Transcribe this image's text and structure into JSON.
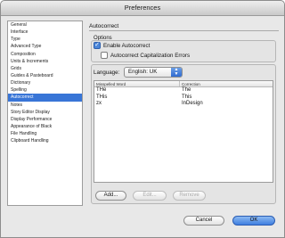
{
  "window": {
    "title": "Preferences"
  },
  "sidebar": {
    "items": [
      "General",
      "Interface",
      "Type",
      "Advanced Type",
      "Composition",
      "Units & Increments",
      "Grids",
      "Guides & Pasteboard",
      "Dictionary",
      "Spelling",
      "Autocorrect",
      "Notes",
      "Story Editor Display",
      "Display Performance",
      "Appearance of Black",
      "File Handling",
      "Clipboard Handling"
    ],
    "selected_index": 10
  },
  "panel": {
    "title": "Autocorrect",
    "options": {
      "label": "Options",
      "enable_autocorrect": {
        "label": "Enable Autocorrect",
        "checked": true
      },
      "autocorrect_capitalization": {
        "label": "Autocorrect Capitalization Errors",
        "checked": false
      }
    },
    "language": {
      "label": "Language:",
      "value": "English: UK"
    },
    "table": {
      "headers": [
        "Misspelled Word",
        "Correction"
      ],
      "rows": [
        [
          "THe",
          "The"
        ],
        [
          "THis",
          "This"
        ],
        [
          "zx",
          "InDesign"
        ]
      ]
    },
    "buttons": {
      "add": "Add...",
      "edit": "Edit...",
      "remove": "Remove"
    }
  },
  "footer": {
    "cancel": "Cancel",
    "ok": "OK"
  },
  "colors": {
    "selection": "#3875d7",
    "primary_button": "#3f7fe0"
  }
}
